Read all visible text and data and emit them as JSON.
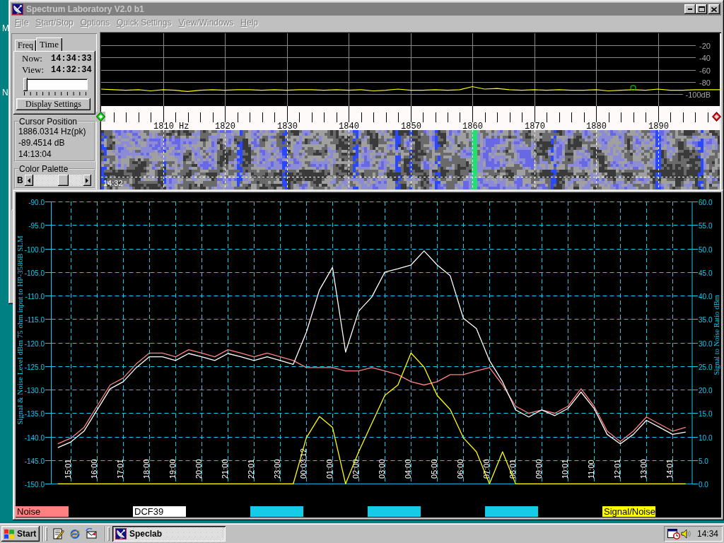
{
  "desktop": {
    "icon_labels": [
      "M",
      "N"
    ]
  },
  "main_window": {
    "title": "Spectrum Laboratory V2.0 b1",
    "menu": [
      {
        "label": "File",
        "disabled": true
      },
      {
        "label": "Start/Stop",
        "disabled": true
      },
      {
        "label": "Options",
        "disabled": true
      },
      {
        "label": "Quick Settings",
        "disabled": true
      },
      {
        "label": "View/Windows",
        "disabled": true
      },
      {
        "label": "Help",
        "disabled": true
      }
    ],
    "side_panel": {
      "tabs": [
        {
          "label": "Freq",
          "selected": false
        },
        {
          "label": "Time",
          "selected": true
        }
      ],
      "times": [
        {
          "label": "Now:",
          "value": "14:34:33"
        },
        {
          "label": "View:",
          "value": "14:32:34"
        }
      ],
      "time_slider": {
        "level": 0
      },
      "display_settings_button": "Display Settings",
      "cursor_position": {
        "title": "Cursor Position",
        "lines": [
          "1886.0314 Hz(pk)",
          "-89.4514 dB",
          "14:13:04"
        ]
      },
      "color_palette": {
        "title": "Color Palette",
        "label": "B",
        "slider": {
          "level": 0.6
        }
      }
    },
    "spectrum": {
      "chart_data": {
        "type": "line",
        "grid": true,
        "xlabel": "Hz",
        "xlim": [
          1800,
          1900
        ],
        "ylim": [
          -120,
          0
        ],
        "xticks": [
          {
            "value": 1810,
            "label": "1810"
          },
          {
            "value": 1820,
            "label": "1820"
          },
          {
            "value": 1830,
            "label": "1830"
          },
          {
            "value": 1840,
            "label": "1840"
          },
          {
            "value": 1850,
            "label": "1850"
          },
          {
            "value": 1860,
            "label": "1860"
          },
          {
            "value": 1870,
            "label": "1870"
          },
          {
            "value": 1880,
            "label": "1880"
          },
          {
            "value": 1890,
            "label": "1890"
          }
        ],
        "yticks": [
          {
            "value": -20,
            "label": "-20"
          },
          {
            "value": -40,
            "label": "-40"
          },
          {
            "value": -60,
            "label": "-60"
          },
          {
            "value": -80,
            "label": "-80"
          },
          {
            "value": -100,
            "label": "-100dB"
          }
        ],
        "x": [
          1800,
          1802,
          1804,
          1806,
          1808,
          1810,
          1812,
          1814,
          1816,
          1818,
          1820,
          1822,
          1824,
          1826,
          1828,
          1830,
          1832,
          1834,
          1836,
          1838,
          1840,
          1842,
          1844,
          1846,
          1848,
          1850,
          1852,
          1854,
          1856,
          1858,
          1860,
          1862,
          1864,
          1866,
          1868,
          1870,
          1872,
          1874,
          1876,
          1878,
          1880,
          1882,
          1884,
          1886,
          1888,
          1890,
          1892,
          1894,
          1896,
          1898,
          1900
        ],
        "series": [
          {
            "color": "#ffff00",
            "values": [
              -92,
              -93,
              -94,
              -93,
              -95,
              -93,
              -94,
              -96,
              -94,
              -93,
              -94,
              -93,
              -93,
              -94,
              -93,
              -94,
              -93,
              -93,
              -94,
              -93,
              -94,
              -93,
              -95,
              -94,
              -92,
              -94,
              -94,
              -93,
              -94,
              -93,
              -88,
              -92,
              -91,
              -93,
              -94,
              -93,
              -94,
              -93,
              -94,
              -94,
              -93,
              -95,
              -94,
              -93,
              -94,
              -92,
              -94,
              -94,
              -93,
              -93,
              -93
            ]
          },
          {
            "color": "#00c000",
            "marker": "circle",
            "values": [
              null,
              null,
              null,
              null,
              null,
              null,
              null,
              null,
              null,
              null,
              null,
              null,
              null,
              null,
              null,
              null,
              null,
              null,
              null,
              null,
              null,
              null,
              null,
              null,
              null,
              null,
              null,
              null,
              null,
              null,
              null,
              null,
              null,
              null,
              null,
              null,
              null,
              null,
              null,
              null,
              null,
              null,
              null,
              -90,
              null,
              null,
              null,
              null,
              null,
              null,
              null
            ]
          }
        ]
      }
    },
    "waterfall": {
      "time_label": "14:32"
    }
  },
  "chart_window": {
    "chart_data": {
      "type": "line",
      "grid": true,
      "ylabel": "Signal & Noise Level dBm 75 ohm input to HP-3586B SLM",
      "y2label": "Signal to Noise Ratio dBm",
      "categories": [
        null,
        "15:01",
        null,
        "16:00",
        null,
        "17:01",
        null,
        "18:00",
        null,
        "19:00",
        null,
        "20:00",
        null,
        "21:00",
        null,
        "22:01",
        null,
        "23:00",
        null,
        "00:03:12",
        null,
        "01:00",
        null,
        "02:00",
        null,
        "03:00",
        null,
        "04:00",
        null,
        "05:00",
        null,
        "06:00",
        null,
        "07:00",
        null,
        "08:01",
        null,
        "09:00",
        null,
        "10:01",
        null,
        "11:00",
        null,
        "12:01",
        null,
        "13:00",
        null,
        "14:01",
        null
      ],
      "ylim": [
        -150,
        -90
      ],
      "y2lim": [
        0,
        60
      ],
      "yticks": [
        {
          "value": -90,
          "label": "-90.0"
        },
        {
          "value": -95,
          "label": "-95.0"
        },
        {
          "value": -100,
          "label": "-100.0"
        },
        {
          "value": -105,
          "label": "-105.0"
        },
        {
          "value": -110,
          "label": "-110.0"
        },
        {
          "value": -115,
          "label": "-115.0"
        },
        {
          "value": -120,
          "label": "-120.0"
        },
        {
          "value": -125,
          "label": "-125.0"
        },
        {
          "value": -130,
          "label": "-130.0"
        },
        {
          "value": -135,
          "label": "-135.0"
        },
        {
          "value": -140,
          "label": "-140.0"
        },
        {
          "value": -145,
          "label": "-145.0"
        },
        {
          "value": -150,
          "label": "-150.0"
        }
      ],
      "y2ticks": [
        {
          "value": 60,
          "label": "60.0"
        },
        {
          "value": 55,
          "label": "55.0"
        },
        {
          "value": 50,
          "label": "50.0"
        },
        {
          "value": 45,
          "label": "45.0"
        },
        {
          "value": 40,
          "label": "40.0"
        },
        {
          "value": 35,
          "label": "35.0"
        },
        {
          "value": 30,
          "label": "30.0"
        },
        {
          "value": 25,
          "label": "25.0"
        },
        {
          "value": 20,
          "label": "20.0"
        },
        {
          "value": 15,
          "label": "15.0"
        },
        {
          "value": 10,
          "label": "10.0"
        },
        {
          "value": 5,
          "label": "5.0"
        },
        {
          "value": 0,
          "label": "0.0"
        }
      ],
      "series": [
        {
          "color": "#ff8080",
          "values": [
            -141.5,
            -140.3,
            -138,
            -133.5,
            -129,
            -127.5,
            -124.5,
            -122.2,
            -122.2,
            -123,
            -121.5,
            -122.2,
            -123,
            -121.5,
            -122.2,
            -123,
            -122.2,
            -123,
            -123.8,
            -125.3,
            -125.3,
            -125.3,
            -126,
            -126,
            -125.3,
            -126,
            -126.8,
            -128.3,
            -129,
            -128.3,
            -126.8,
            -126.8,
            -126,
            -125.3,
            -129,
            -133.5,
            -135,
            -134.3,
            -135,
            -133.5,
            -129.8,
            -133.5,
            -138.8,
            -141,
            -138.8,
            -135.8,
            -137.3,
            -138.8,
            -138
          ]
        },
        {
          "color": "#ffffff",
          "values": [
            -142.3,
            -141.1,
            -138.8,
            -134.3,
            -129.8,
            -128.3,
            -125.3,
            -123,
            -123,
            -123.8,
            -122.3,
            -123,
            -123.8,
            -122.3,
            -123,
            -123.8,
            -123,
            -123.8,
            -124.6,
            -117.8,
            -108.8,
            -104,
            -122,
            -113.3,
            -110.3,
            -105,
            -104.3,
            -103.5,
            -100.5,
            -103.5,
            -105.8,
            -114.8,
            -117,
            -123.8,
            -128.3,
            -134.3,
            -135.8,
            -134.3,
            -135.5,
            -134,
            -130.5,
            -134,
            -139.5,
            -141.5,
            -139.5,
            -136.5,
            -138,
            -139.5,
            -139
          ]
        },
        {
          "color": "#ffff00",
          "axis": "y2",
          "values": [
            0,
            0,
            0,
            0,
            0,
            0,
            0,
            0,
            0,
            0,
            0,
            0,
            0,
            0,
            0,
            0,
            0,
            0,
            0,
            9.8,
            14.3,
            12,
            0,
            6.8,
            12.8,
            18.8,
            21,
            27.8,
            24.8,
            18.8,
            15.8,
            9.8,
            6.8,
            0,
            6.8,
            0,
            0,
            0,
            0,
            0,
            0,
            0,
            0,
            0,
            0,
            0,
            0,
            0,
            0
          ]
        }
      ]
    },
    "legend": [
      {
        "label": "Noise",
        "color": "#ff8080"
      },
      {
        "label": "DCF39",
        "color": "#ffffff"
      },
      {
        "color": "#14cce8"
      },
      {
        "color": "#14cce8"
      },
      {
        "color": "#14cce8"
      },
      {
        "label": "Signal/Noise",
        "color": "#ffff00"
      }
    ]
  },
  "taskbar": {
    "start_button": "Start",
    "tasks": [
      {
        "label": "Speclab",
        "selected": true
      }
    ],
    "clock": "14:34"
  }
}
